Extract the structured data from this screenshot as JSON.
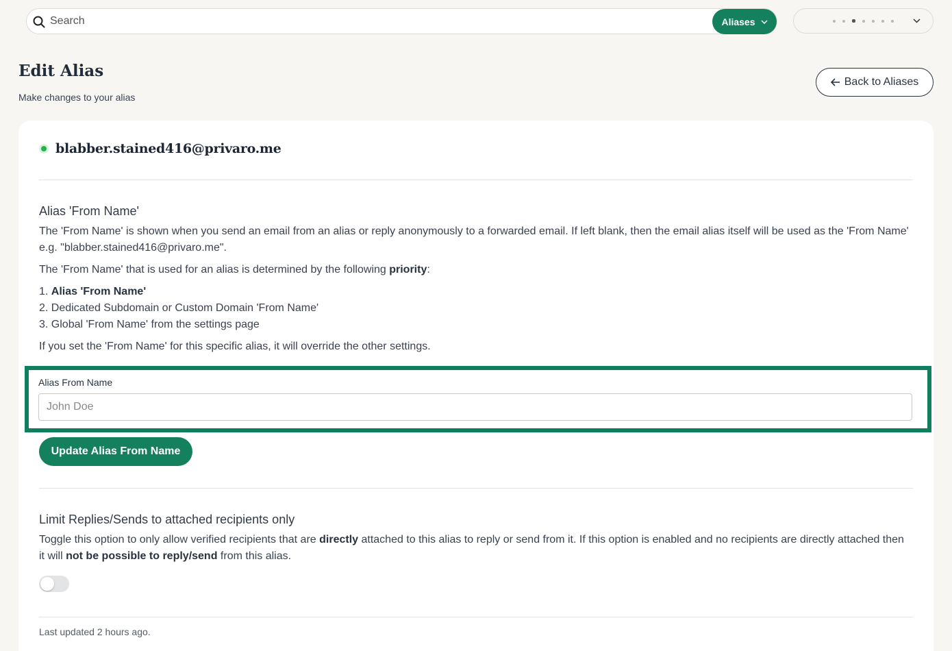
{
  "search": {
    "placeholder": "Search"
  },
  "scope_button": {
    "label": "Aliases"
  },
  "header": {
    "title": "Edit Alias",
    "subtitle": "Make changes to your alias",
    "back_label": "Back to Aliases"
  },
  "alias": {
    "email": "blabber.stained416@privaro.me",
    "status": "active"
  },
  "from_name_section": {
    "title": "Alias 'From Name'",
    "description_1": "The 'From Name' is shown when you send an email from an alias or reply anonymously to a forwarded email. If left blank, then the email alias itself will be used as the 'From Name' e.g. \"blabber.stained416@privaro.me\".",
    "priority_prefix": "The 'From Name' that is used for an alias is determined by the following ",
    "priority_bold": "priority",
    "priority_suffix": ":",
    "priority_list": [
      {
        "num": "1.",
        "text": "Alias 'From Name'"
      },
      {
        "num": "2.",
        "text": "Dedicated Subdomain or Custom Domain 'From Name'"
      },
      {
        "num": "3.",
        "text": "Global 'From Name' from the settings page"
      }
    ],
    "override_note": "If you set the 'From Name' for this specific alias, it will override the other settings.",
    "field_label": "Alias From Name",
    "field_placeholder": "John Doe",
    "field_value": "",
    "update_label": "Update Alias From Name"
  },
  "limit_section": {
    "title": "Limit Replies/Sends to attached recipients only",
    "desc_part1": "Toggle this option to only allow verified recipients that are ",
    "desc_bold1": "directly",
    "desc_part2": " attached to this alias to reply or send from it. If this option is enabled and no recipients are directly attached then it will ",
    "desc_bold2": "not be possible to reply/send",
    "desc_part3": " from this alias.",
    "toggle_enabled": false
  },
  "footer": {
    "last_updated": "Last updated 2 hours ago."
  },
  "colors": {
    "accent": "#14805e",
    "focus_outline": "#0f7f60",
    "status_active": "#27b24a"
  }
}
